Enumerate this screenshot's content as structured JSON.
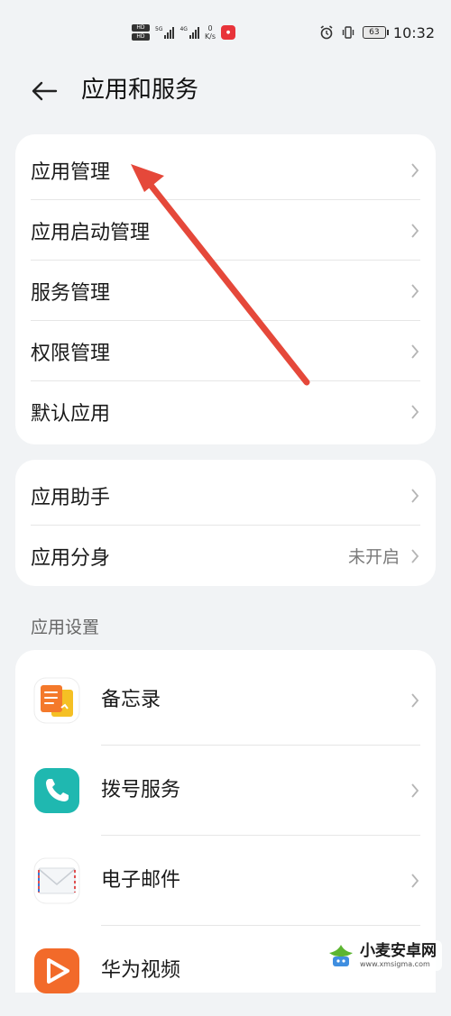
{
  "status_bar": {
    "hd1": "HD",
    "hd2": "HD",
    "sig1_label": "5G",
    "sig2_label": "4G",
    "speed_value": "0",
    "speed_unit": "K/s",
    "battery": "63",
    "time": "10:32"
  },
  "header": {
    "title": "应用和服务"
  },
  "group1": {
    "items": [
      {
        "label": "应用管理"
      },
      {
        "label": "应用启动管理"
      },
      {
        "label": "服务管理"
      },
      {
        "label": "权限管理"
      },
      {
        "label": "默认应用"
      }
    ]
  },
  "group2": {
    "items": [
      {
        "label": "应用助手",
        "value": ""
      },
      {
        "label": "应用分身",
        "value": "未开启"
      }
    ]
  },
  "app_settings": {
    "section_title": "应用设置",
    "items": [
      {
        "label": "备忘录",
        "icon": "notes-icon"
      },
      {
        "label": "拨号服务",
        "icon": "phone-icon"
      },
      {
        "label": "电子邮件",
        "icon": "email-icon"
      },
      {
        "label": "华为视频",
        "icon": "video-icon"
      }
    ]
  },
  "watermark": {
    "main": "小麦安卓网",
    "sub": "www.xmsigma.com"
  },
  "colors": {
    "background": "#f1f3f5",
    "card": "#ffffff",
    "annotation_arrow": "#e5483a",
    "phone_icon": "#1fb8b0",
    "notes_orange": "#f4792b",
    "notes_yellow": "#f5c024",
    "video_orange": "#f26a2a"
  }
}
